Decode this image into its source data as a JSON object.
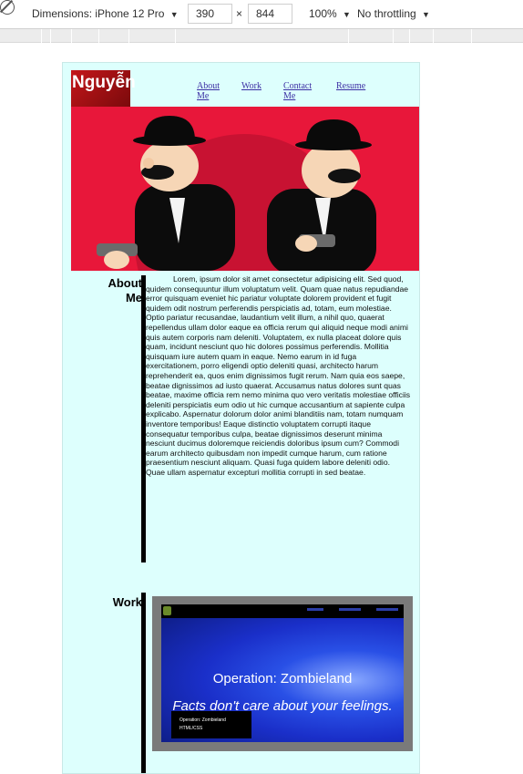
{
  "devtools": {
    "dimensions_label": "Dimensions: iPhone 12 Pro",
    "width": "390",
    "times": "×",
    "height": "844",
    "zoom": "100%",
    "throttling": "No throttling",
    "caret": "▼",
    "rotate_icon": "rotate-icon"
  },
  "site": {
    "logo": "Nguyễn",
    "nav": [
      "About Me",
      "Work",
      "Contact Me",
      "Resume"
    ],
    "about": {
      "heading": "About Me",
      "body": "Lorem, ipsum dolor sit amet consectetur adipisicing elit. Sed quod, quidem consequuntur illum voluptatum velit. Quam quae natus repudiandae error quisquam eveniet hic pariatur voluptate dolorem provident et fugit quidem odit nostrum perferendis perspiciatis ad, totam, eum molestiae. Optio pariatur recusandae, laudantium velit illum, a nihil quo, quaerat repellendus ullam dolor eaque ea officia rerum qui aliquid neque modi animi quis autem corporis nam deleniti. Voluptatem, ex nulla placeat dolore quis quam, incidunt nesciunt quo hic dolores possimus perferendis. Mollitia quisquam iure autem quam in eaque. Nemo earum in id fuga exercitationem, porro eligendi optio deleniti quasi, architecto harum reprehenderit ea, quos enim dignissimos fugit rerum. Nam quia eos saepe, beatae dignissimos ad iusto quaerat. Accusamus natus dolores sunt quas beatae, maxime officia rem nemo minima quo vero veritatis molestiae officiis deleniti perspiciatis eum odio ut hic cumque accusantium at sapiente culpa explicabo. Aspernatur dolorum dolor animi blanditiis nam, totam numquam inventore temporibus! Eaque distinctio voluptatem corrupti itaque consequatur temporibus culpa, beatae dignissimos deserunt minima nesciunt ducimus doloremque reiciendis doloribus ipsum cum? Commodi earum architecto quibusdam non impedit cumque harum, cum ratione praesentium nesciunt aliquam. Quasi fuga quidem labore deleniti odio. Quae ullam aspernatur excepturi mollitia corrupti in sed beatae."
    },
    "work": {
      "heading": "Work",
      "project_title": "Operation: Zombieland",
      "project_tagline": "Facts don't care about your feelings.",
      "card_label_title": "Operation: Zombieland",
      "card_label_tech": "HTML/CSS"
    }
  },
  "colors": {
    "page_bg": "#ddfffd",
    "hero_bg": "#e8173a",
    "logo_bg": "#c4161a",
    "nav_link": "#3c2fa4"
  }
}
